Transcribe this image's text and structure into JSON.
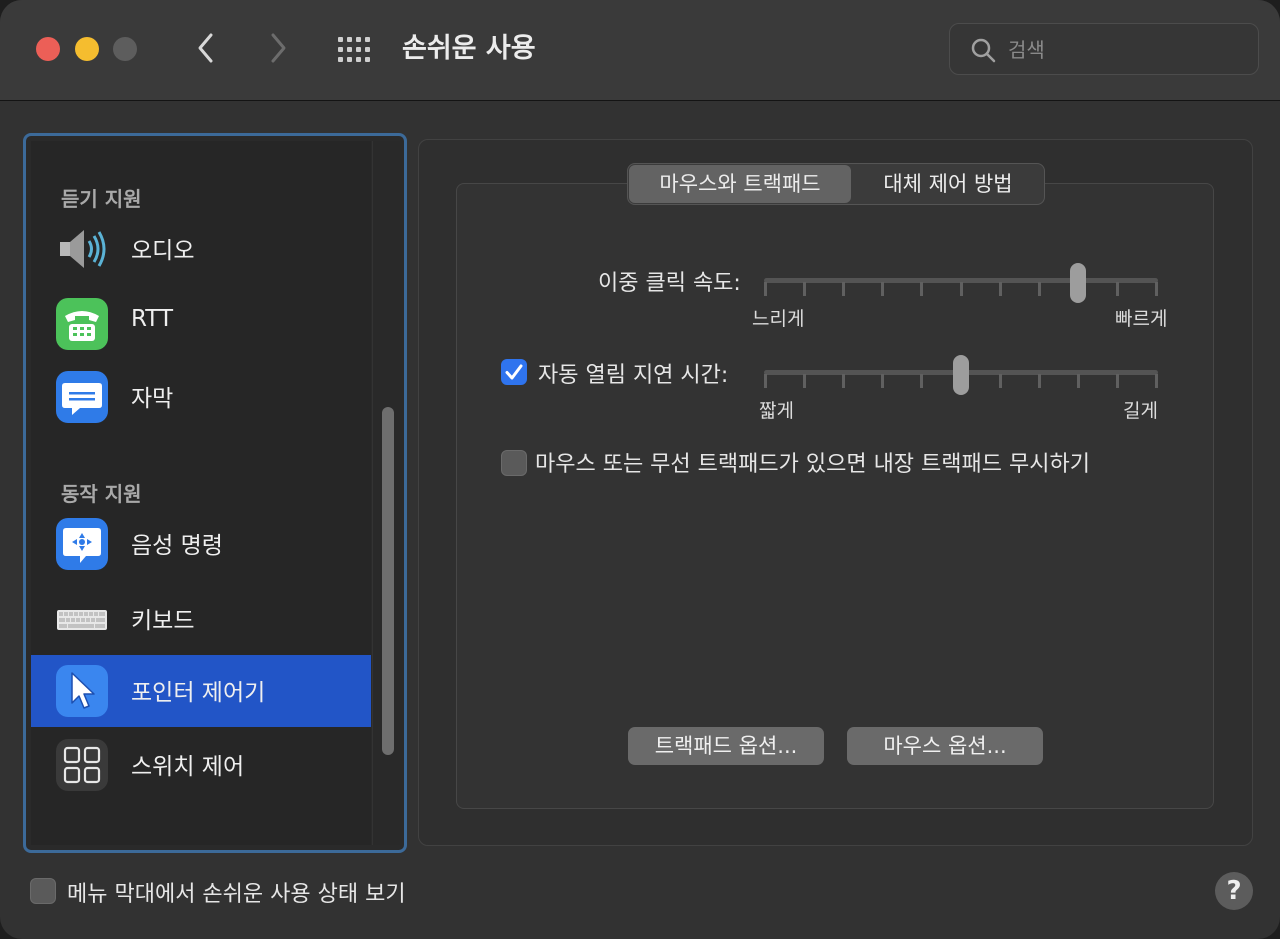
{
  "window": {
    "title": "손쉬운 사용",
    "search_placeholder": "검색"
  },
  "sidebar": {
    "sections": [
      {
        "header": "듣기 지원",
        "items": [
          {
            "label": "오디오",
            "icon": "speaker-icon"
          },
          {
            "label": "RTT",
            "icon": "tty-phone-icon"
          },
          {
            "label": "자막",
            "icon": "captions-icon"
          }
        ]
      },
      {
        "header": "동작 지원",
        "items": [
          {
            "label": "음성 명령",
            "icon": "voice-control-icon"
          },
          {
            "label": "키보드",
            "icon": "keyboard-icon"
          },
          {
            "label": "포인터 제어기",
            "icon": "pointer-icon",
            "selected": true
          },
          {
            "label": "스위치 제어",
            "icon": "switch-control-icon"
          }
        ]
      }
    ]
  },
  "tabs": [
    {
      "label": "마우스와 트랙패드",
      "active": true
    },
    {
      "label": "대체 제어 방법",
      "active": false
    }
  ],
  "settings": {
    "double_click_speed": {
      "label": "이중 클릭 속도:",
      "min_label": "느리게",
      "max_label": "빠르게",
      "ticks": 11,
      "value_index": 8
    },
    "spring_loading": {
      "label": "자동 열림 지연 시간:",
      "checked": true,
      "min_label": "짧게",
      "max_label": "길게",
      "ticks": 11,
      "value_index": 5
    },
    "ignore_trackpad": {
      "label": "마우스 또는 무선 트랙패드가 있으면 내장 트랙패드 무시하기",
      "checked": false
    }
  },
  "buttons": {
    "trackpad_options": "트랙패드 옵션...",
    "mouse_options": "마우스 옵션..."
  },
  "footer": {
    "menu_bar_label": "메뉴 막대에서 손쉬운 사용 상태 보기",
    "menu_bar_checked": false,
    "help": "?"
  },
  "colors": {
    "accent": "#2f74ee",
    "selection": "#2255c7",
    "traffic_red": "#ec5f57",
    "traffic_yellow": "#f5bd2f",
    "traffic_gray": "#5d5d5d"
  }
}
